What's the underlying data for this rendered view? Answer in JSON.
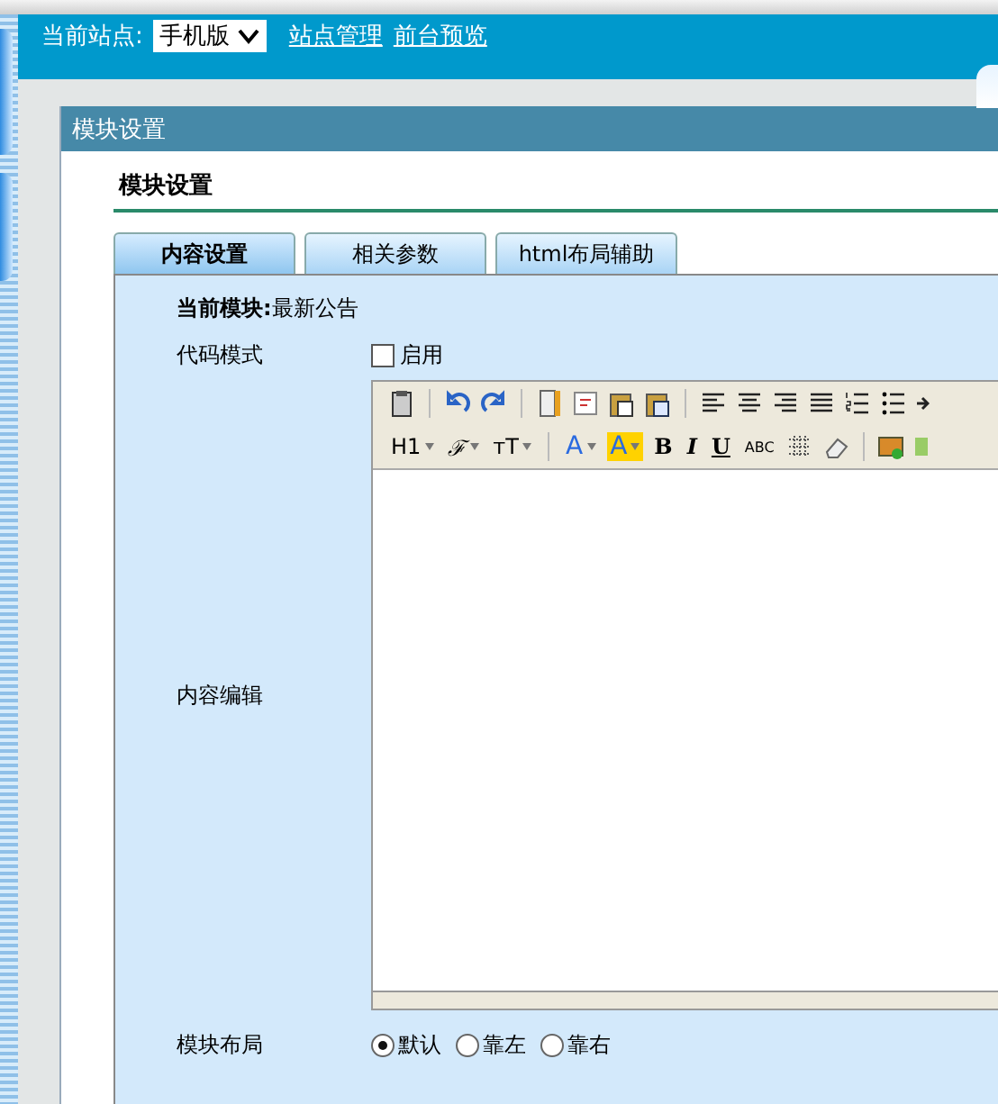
{
  "header": {
    "site_label": "当前站点:",
    "site_select": {
      "value": "手机版"
    },
    "links": [
      "站点管理",
      "前台预览"
    ]
  },
  "dialog": {
    "title": "模块设置",
    "heading": "模块设置",
    "tabs": [
      {
        "label": "内容设置",
        "selected": true
      },
      {
        "label": "相关参数",
        "selected": false
      },
      {
        "label": "html布局辅助",
        "selected": false
      }
    ],
    "current_module": {
      "label": "当前模块:",
      "value": "最新公告"
    },
    "code_mode": {
      "label": "代码模式",
      "option": "启用",
      "checked": false
    },
    "content_label": "内容编辑",
    "editor": {
      "toolbar_row2": [
        {
          "kind": "text",
          "label": "H1",
          "dropdown": true
        },
        {
          "kind": "script",
          "label": "ℱ",
          "dropdown": true
        },
        {
          "kind": "text",
          "label": "ᴛT",
          "dropdown": true
        },
        {
          "kind": "separator"
        },
        {
          "kind": "color",
          "label": "A",
          "dropdown": true
        },
        {
          "kind": "highlight",
          "label": "A",
          "dropdown": true
        },
        {
          "kind": "bold",
          "label": "B",
          "dropdown": false
        },
        {
          "kind": "italic",
          "label": "I",
          "dropdown": false
        },
        {
          "kind": "underline",
          "label": "U",
          "dropdown": false
        },
        {
          "kind": "small",
          "label": "ABC",
          "dropdown": false
        }
      ]
    },
    "layout": {
      "label": "模块布局",
      "options": [
        {
          "label": "默认",
          "selected": true
        },
        {
          "label": "靠左",
          "selected": false
        },
        {
          "label": "靠右",
          "selected": false
        }
      ]
    }
  }
}
